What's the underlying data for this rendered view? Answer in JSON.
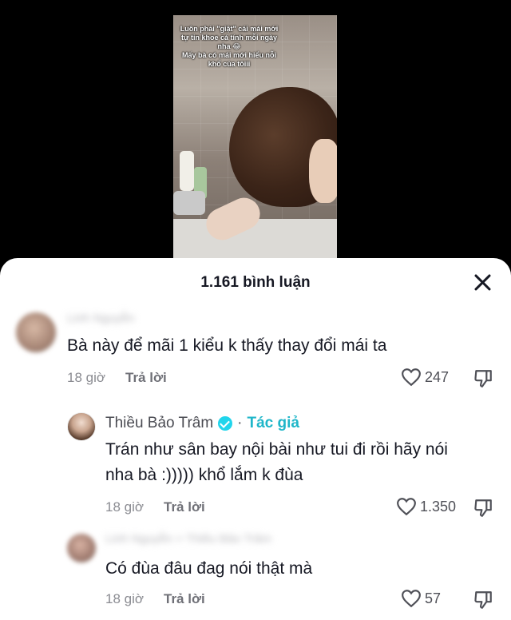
{
  "video": {
    "caption_lines": [
      "Luôn phải \"giật\" cái mái mới",
      "tự tin khoe cá tính mỗi ngày",
      "nha 😂",
      "Mấy bà có mái mới hiểu nỗi",
      "khổ của tôiii"
    ]
  },
  "sheet": {
    "comment_count": "1.161 bình luận"
  },
  "comments": [
    {
      "username": "Linh Nguyễn",
      "text": "Bà này để mãi 1 kiểu k thấy thay đổi mái ta",
      "time": "18 giờ",
      "reply_label": "Trả lời",
      "likes": "247"
    },
    {
      "username": "Thiều Bảo Trâm",
      "author_sep": "·",
      "author_tag": "Tác giả",
      "text_line1": "Trán như sân bay nội bài như tui đi rồi hãy nói",
      "text_line2": "nha bà :))))) khổ lắm k đùa",
      "time": "18 giờ",
      "reply_label": "Trả lời",
      "likes": "1.350"
    },
    {
      "username": "Linh Nguyễn > Thiều Bảo Trâm",
      "text": "Có đùa đâu đag nói thật mà",
      "time": "18 giờ",
      "reply_label": "Trả lời",
      "likes": "57"
    }
  ],
  "colors": {
    "verified": "#20d5ec",
    "author_tag": "#1fb6c9",
    "text": "#161823",
    "muted": "#8a8b91"
  }
}
